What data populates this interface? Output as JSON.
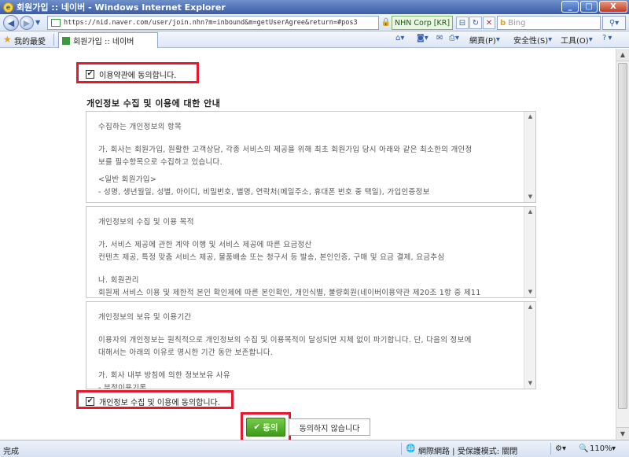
{
  "window": {
    "title": "회원가입 :: 네이버 - Windows Internet Explorer",
    "buttons": {
      "minimize": "_",
      "maximize": "□",
      "close": "X"
    }
  },
  "address_bar": {
    "url": "https://nid.naver.com/user/join.nhn?m=inbound&m=getUserAgree&return=#pos3",
    "cert_label": "NHN Corp [KR]",
    "search_placeholder": "Bing",
    "dropdown_glyph": "▼"
  },
  "favorites_bar": {
    "favorites_label": "我的最愛",
    "tab_title": "회원가입 :: 네이버",
    "commands": {
      "page": "網頁(P)",
      "safety": "安全性(S)",
      "tools": "工具(O)",
      "help": "?"
    }
  },
  "content": {
    "agree_terms_label": "이용약관에 동의합니다.",
    "privacy_section_title": "개인정보 수집 및 이용에 대한 안내",
    "box1": {
      "heading": "수집하는 개인정보의 항목",
      "para1_line1": "가. 회사는 회원가입, 원활한 고객상담, 각종 서비스의 제공을 위해 최초 회원가입 당시 아래와 같은 최소한의 개인정",
      "para1_line2": "보를 필수항목으로 수집하고 있습니다.",
      "subhead": "<일반 회원가입>",
      "item1": "- 성명, 생년월일, 성별, 아이디, 비밀번호, 별명, 연락처(메일주소, 휴대폰 번호 중 택일), 가입인증정보"
    },
    "box2": {
      "heading": "개인정보의 수집 및 이용 목적",
      "para1_line1": "가. 서비스 제공에 관한 계약 이행 및 서비스 제공에 따른 요금정산",
      "para1_line2": "컨텐츠 제공, 특정 맞춤 서비스 제공, 물품배송 또는 청구서 등 발송, 본인인증, 구매 및 요금 결제, 요금추심",
      "para2_head": "나. 회원관리",
      "para2_line1": "회원제 서비스 이용 및 제한적 본인 확인제에 따른 본인확인, 개인식별, 불량회원(네이버이용약관 제20조 1항 중 제11"
    },
    "box3": {
      "heading": "개인정보의 보유 및 이용기간",
      "para1_line1": "이용자의 개인정보는 원칙적으로 개인정보의 수집 및 이용목적이 달성되면 지체 없이 파기합니다. 단, 다음의 정보에",
      "para1_line2": "대해서는 아래의 이유로 명시한 기간 동안 보존합니다.",
      "para2_head": "가. 회사 내부 방침에 의한 정보보유 사유",
      "para2_line1": "- 부정이용기록"
    },
    "agree_privacy_label": "개인정보 수집 및 이용에 동의합니다.",
    "agree_button": "동의",
    "disagree_button": "동의하지 않습니다",
    "checkbox_mark": "✔"
  },
  "status_bar": {
    "status_text": "完成",
    "zone_text": "網際網路 | 受保護模式: 關閉",
    "zoom": "110%"
  },
  "colors": {
    "highlight": "#e8172b",
    "agree_button": "#4fae24",
    "titlebar": "#3a5da8"
  }
}
